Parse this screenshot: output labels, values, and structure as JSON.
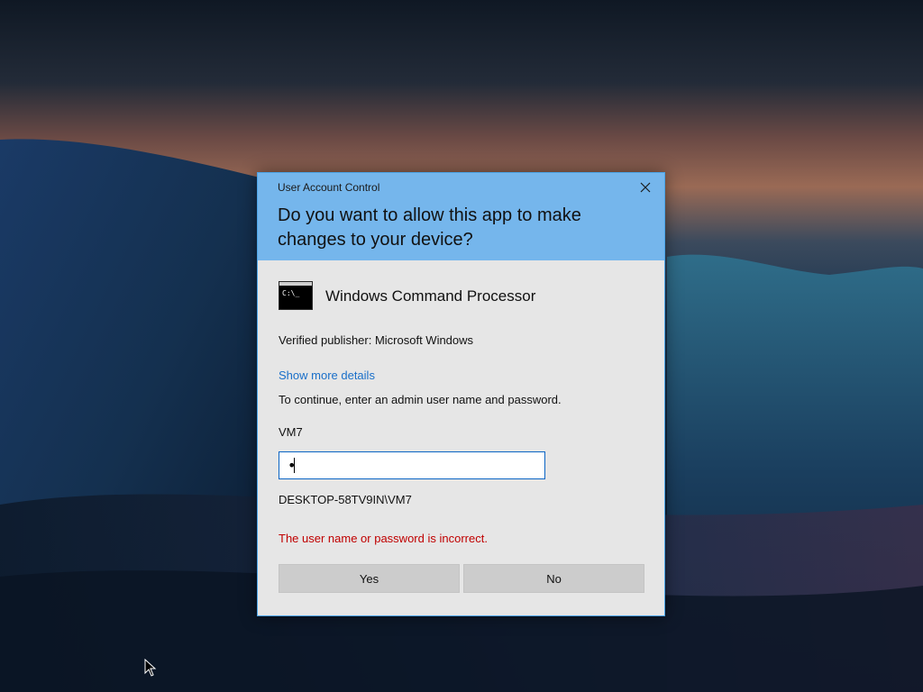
{
  "uac": {
    "title": "User Account Control",
    "question": "Do you want to allow this app to make changes to your device?",
    "app_name": "Windows Command Processor",
    "app_icon": "command-prompt-icon",
    "publisher": "Verified publisher: Microsoft Windows",
    "details_link": "Show more details",
    "instructions": "To continue, enter an admin user name and password.",
    "username": "VM7",
    "password_value": "•",
    "domain_user": "DESKTOP-58TV9IN\\VM7",
    "error": "The user name or password is incorrect.",
    "yes_label": "Yes",
    "no_label": "No",
    "icon_prompt_text": "C:\\_"
  },
  "colors": {
    "header": "#75b6ec",
    "body": "#e6e6e6",
    "link": "#1a6fc9",
    "error": "#c00000",
    "focus_border": "#0a64c4"
  }
}
